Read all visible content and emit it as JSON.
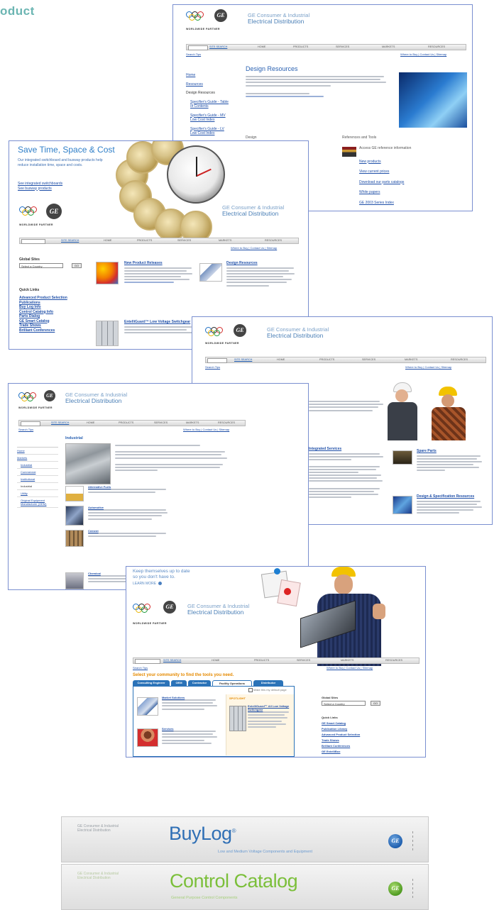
{
  "page": {
    "header_fragment": "oduct"
  },
  "brand": {
    "line1": "GE Consumer & Industrial",
    "line2": "Electrical Distribution",
    "partner": "WORLDWIDE PARTNER",
    "ge_mark": "GE"
  },
  "nav": {
    "site_search": "SITE SEARCH",
    "home": "HOME",
    "products": "PRODUCTS",
    "services": "SERVICES",
    "markets": "MARKETS",
    "resources": "RESOURCES",
    "search_tips": "Search Tips",
    "utility_links": "Where to Buy | Contact Us | Sitemap"
  },
  "shot1": {
    "title": "Design Resources",
    "sidebar": [
      "Home",
      "Resources",
      "Design Resources",
      "Specifier's Guide - Table of Contents",
      "Specifier's Guide - MV Low Cost Index",
      "Specifier's Guide - LV Low Cost Index"
    ],
    "col_left": "Design",
    "col_right": "References and Tools",
    "tools": [
      "Access GE reference information",
      "New products",
      "View current prices",
      "Download our parts catalogs",
      "White papers",
      "GE 2003 Series Index"
    ]
  },
  "shot2": {
    "headline": "Save Time, Space & Cost",
    "blurb": "Our integrated switchboard and busway products help reduce installation time, space and costs.",
    "links": [
      "See integrated switchboards",
      "See busway products"
    ],
    "global_sites": "Global Sites",
    "select_country": "Select a Country",
    "go": "GO",
    "quick_links_title": "Quick Links",
    "quick_links": [
      "Advanced Product Selection",
      "Publications",
      "Buy Log Info",
      "Control Catalog Info",
      "Parts Dialog",
      "GE Smart Catalog",
      "Trade Shows",
      "Brilliant Conferences"
    ],
    "news1_title": "New Product Releases",
    "news2_title": "Design Resources",
    "news3_title": "EntelliGuard™ Low Voltage Switchgear"
  },
  "shot3": {
    "items": [
      "Integrated Services",
      "Spare Parts",
      "Design & Specification Resources"
    ]
  },
  "shot4": {
    "title": "Industrial",
    "sidebar": [
      "Home",
      "Markets",
      "Industrial",
      "Commercial",
      "Institutional",
      "Industrial",
      "Utility",
      "Original Equipment Manufacturer (OEM)"
    ],
    "sections": [
      "Alternative Fuels",
      "Automotive",
      "Cement",
      "Chemical"
    ]
  },
  "shot5": {
    "promo_line1": "Keep themselves up to date",
    "promo_line2": "so you don't have to.",
    "learn_more": "LEARN MORE",
    "community_heading": "Select your community to find the tools you need.",
    "tabs": [
      "Consulting Engineer",
      "OEM",
      "Contractor",
      "Facility Operations",
      "Distributor"
    ],
    "make_default": "Make this my default page",
    "col_items": [
      "Market Solutions",
      "Services"
    ],
    "spotlight": "SPOTLIGHT",
    "spotlight_title": "EntelliGuard™ All Low Voltage Switchgear",
    "global_sites": "Global Sites",
    "select_country": "Select a Country",
    "go": "GO",
    "quick_links_title": "Quick Links",
    "quick_links": [
      "GE Smart Catalog",
      "Publication Library",
      "Advanced Product Selection",
      "Trade Shows",
      "Brilliant Conferences",
      "GE EntelliBox"
    ]
  },
  "banners": [
    {
      "brand1": "GE Consumer & Industrial",
      "brand2": "Electrical Distribution",
      "name": "BuyLog",
      "mark": "®",
      "subtitle": "Low and Medium Voltage Components and Equipment",
      "color": "#2f6fb5"
    },
    {
      "brand1": "GE Consumer & Industrial",
      "brand2": "Electrical Distribution",
      "name": "Control Catalog",
      "mark": "",
      "subtitle": "General Purpose Control Components",
      "color": "#7bbf3a"
    }
  ],
  "colors": {
    "frame": "#7a8fd0",
    "link": "#1f4fa8",
    "accent_orange": "#e58a00",
    "tab_blue": "#2b73b8"
  }
}
